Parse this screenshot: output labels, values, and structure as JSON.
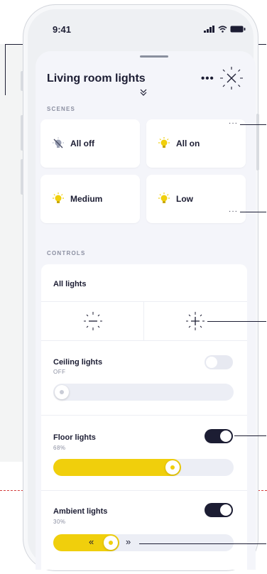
{
  "status_bar": {
    "time": "9:41"
  },
  "sheet": {
    "title": "Living room lights",
    "more_label": "•••",
    "scenes_label": "SCENES",
    "controls_label": "CONTROLS",
    "scenes": [
      {
        "label": "All off",
        "icon": "bulb-off-icon"
      },
      {
        "label": "All on",
        "icon": "bulb-on-icon"
      },
      {
        "label": "Medium",
        "icon": "bulb-on-icon"
      },
      {
        "label": "Low",
        "icon": "bulb-on-icon"
      }
    ],
    "all_lights": {
      "label": "All lights",
      "decrease_icon": "dim-minus-icon",
      "increase_icon": "dim-plus-icon"
    },
    "lights": [
      {
        "name": "Ceiling lights",
        "status": "OFF",
        "on": false,
        "level": 0
      },
      {
        "name": "Floor lights",
        "status": "68%",
        "on": true,
        "level": 0.68
      },
      {
        "name": "Ambient lights",
        "status": "30%",
        "on": true,
        "level": 0.3
      }
    ]
  },
  "colors": {
    "accent": "#f0cf0c",
    "dark": "#1c1d33",
    "sheet_bg": "#f4f5fa",
    "annotation_line": "#d33c3c"
  }
}
